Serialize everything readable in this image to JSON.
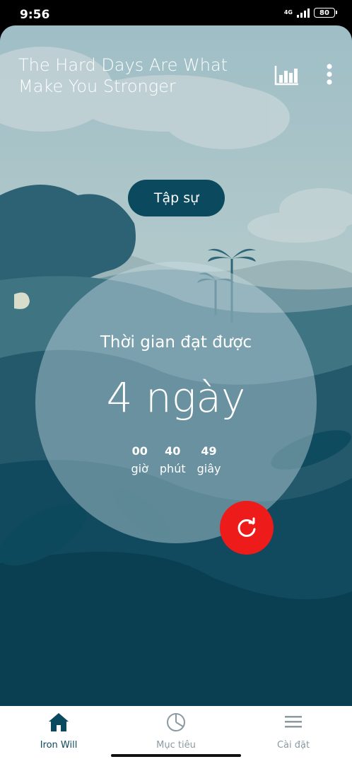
{
  "status_bar": {
    "time": "9:56",
    "network": "4G",
    "battery": "80"
  },
  "header": {
    "quote": "The Hard Days Are What Make You Stronger",
    "stats_icon": "bar-chart-icon",
    "more_icon": "more-vertical-icon"
  },
  "level": {
    "label": "Tập sự"
  },
  "progress": {
    "title": "Thời gian đạt được",
    "main": "4 ngày",
    "hours_value": "00",
    "hours_label": "giờ",
    "minutes_value": "40",
    "minutes_label": "phút",
    "seconds_value": "49",
    "seconds_label": "giây"
  },
  "reset": {
    "icon": "refresh-icon"
  },
  "bottom_nav": {
    "items": [
      {
        "label": "Iron Will",
        "icon": "home-icon",
        "active": true
      },
      {
        "label": "Mục tiêu",
        "icon": "pie-chart-icon",
        "active": false
      },
      {
        "label": "Cài đặt",
        "icon": "menu-icon",
        "active": false
      }
    ]
  },
  "colors": {
    "accent": "#0b4a5e",
    "reset": "#ee1b1b",
    "sky": "#a6c2c8"
  }
}
